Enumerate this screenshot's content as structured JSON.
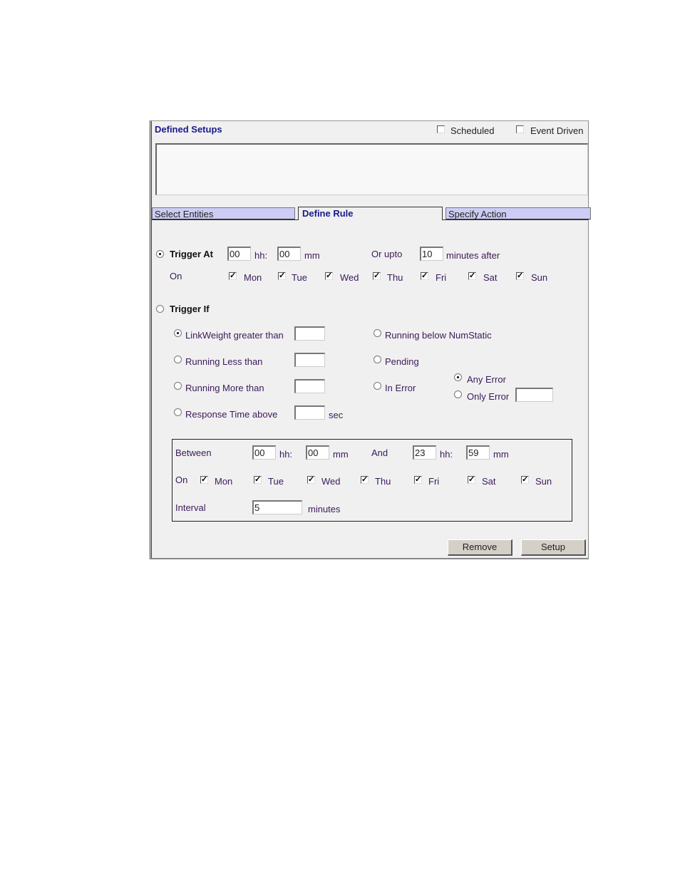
{
  "header": {
    "title": "Defined Setups",
    "scheduled_label": "Scheduled",
    "scheduled_checked": false,
    "event_driven_label": "Event Driven",
    "event_driven_checked": false
  },
  "tabs": [
    {
      "label": "Select Entities",
      "active": false
    },
    {
      "label": "Define Rule",
      "active": true
    },
    {
      "label": "Specify Action",
      "active": false
    }
  ],
  "trigger_at": {
    "label": "Trigger At",
    "selected": true,
    "hh": "00",
    "hh_label": "hh:",
    "mm": "00",
    "mm_label": "mm",
    "or_upto_label": "Or upto",
    "or_upto_value": "10",
    "minutes_after_label": "minutes after",
    "on_label": "On",
    "days": [
      {
        "label": "Mon",
        "checked": true
      },
      {
        "label": "Tue",
        "checked": true
      },
      {
        "label": "Wed",
        "checked": true
      },
      {
        "label": "Thu",
        "checked": true
      },
      {
        "label": "Fri",
        "checked": true
      },
      {
        "label": "Sat",
        "checked": true
      },
      {
        "label": "Sun",
        "checked": true
      }
    ]
  },
  "trigger_if": {
    "label": "Trigger If",
    "selected": false,
    "conditions": [
      {
        "label": "LinkWeight greater than",
        "selected": true,
        "value": ""
      },
      {
        "label": "Running Less than",
        "selected": false,
        "value": ""
      },
      {
        "label": "Running More than",
        "selected": false,
        "value": ""
      },
      {
        "label": "Response Time above",
        "selected": false,
        "value": "",
        "unit": "sec"
      }
    ],
    "right_conditions": [
      {
        "label": "Running below NumStatic",
        "selected": false
      },
      {
        "label": "Pending",
        "selected": false
      },
      {
        "label": "In Error",
        "selected": false
      }
    ],
    "error_options": [
      {
        "label": "Any Error",
        "selected": true
      },
      {
        "label": "Only Error",
        "selected": false,
        "value": ""
      }
    ],
    "window": {
      "between_label": "Between",
      "from_hh": "00",
      "from_mm": "00",
      "and_label": "And",
      "to_hh": "23",
      "to_mm": "59",
      "hh_label": "hh:",
      "mm_label": "mm",
      "on_label": "On",
      "days": [
        {
          "label": "Mon",
          "checked": true
        },
        {
          "label": "Tue",
          "checked": true
        },
        {
          "label": "Wed",
          "checked": true
        },
        {
          "label": "Thu",
          "checked": true
        },
        {
          "label": "Fri",
          "checked": true
        },
        {
          "label": "Sat",
          "checked": true
        },
        {
          "label": "Sun",
          "checked": true
        }
      ],
      "interval_label": "Interval",
      "interval_value": "5",
      "interval_unit": "minutes"
    }
  },
  "buttons": {
    "remove": "Remove",
    "setup": "Setup"
  }
}
